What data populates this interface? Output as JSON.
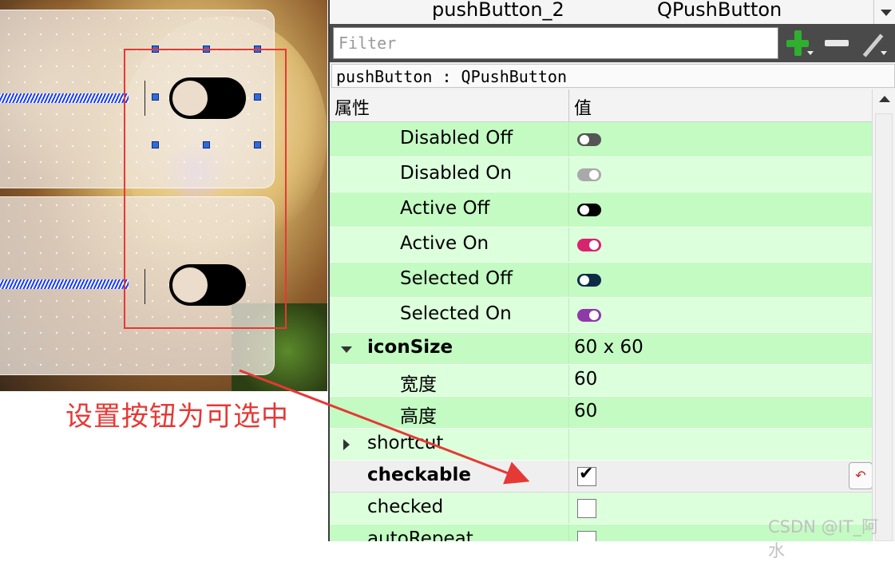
{
  "object_inspector": {
    "name": "pushButton_2",
    "class": "QPushButton"
  },
  "filter": {
    "placeholder": "Filter"
  },
  "class_label": "pushButton : QPushButton",
  "table_header": {
    "property": "属性",
    "value": "值"
  },
  "rows": {
    "disabled_off": {
      "name": "Disabled Off",
      "color": "#555555"
    },
    "disabled_on": {
      "name": "Disabled On",
      "color": "#a9a9a9"
    },
    "active_off": {
      "name": "Active Off",
      "color": "#000000"
    },
    "active_on": {
      "name": "Active On",
      "color": "#d6246e"
    },
    "selected_off": {
      "name": "Selected Off",
      "color": "#0d2b45"
    },
    "selected_on": {
      "name": "Selected On",
      "color": "#8e3aa8"
    },
    "icon_size": {
      "name": "iconSize",
      "value": "60 x 60"
    },
    "width": {
      "name": "宽度",
      "value": "60"
    },
    "height": {
      "name": "高度",
      "value": "60"
    },
    "shortcut": {
      "name": "shortcut",
      "value": ""
    },
    "checkable": {
      "name": "checkable",
      "checked": true
    },
    "checked": {
      "name": "checked",
      "checked": false
    },
    "auto_repeat": {
      "name": "autoRepeat",
      "checked": false
    }
  },
  "annotation": "设置按钮为可选中",
  "watermark": "CSDN @IT_阿水",
  "colors": {
    "annotation_red": "#e53935",
    "row_dark": "#c3fbc3",
    "row_light": "#dcffdc"
  }
}
